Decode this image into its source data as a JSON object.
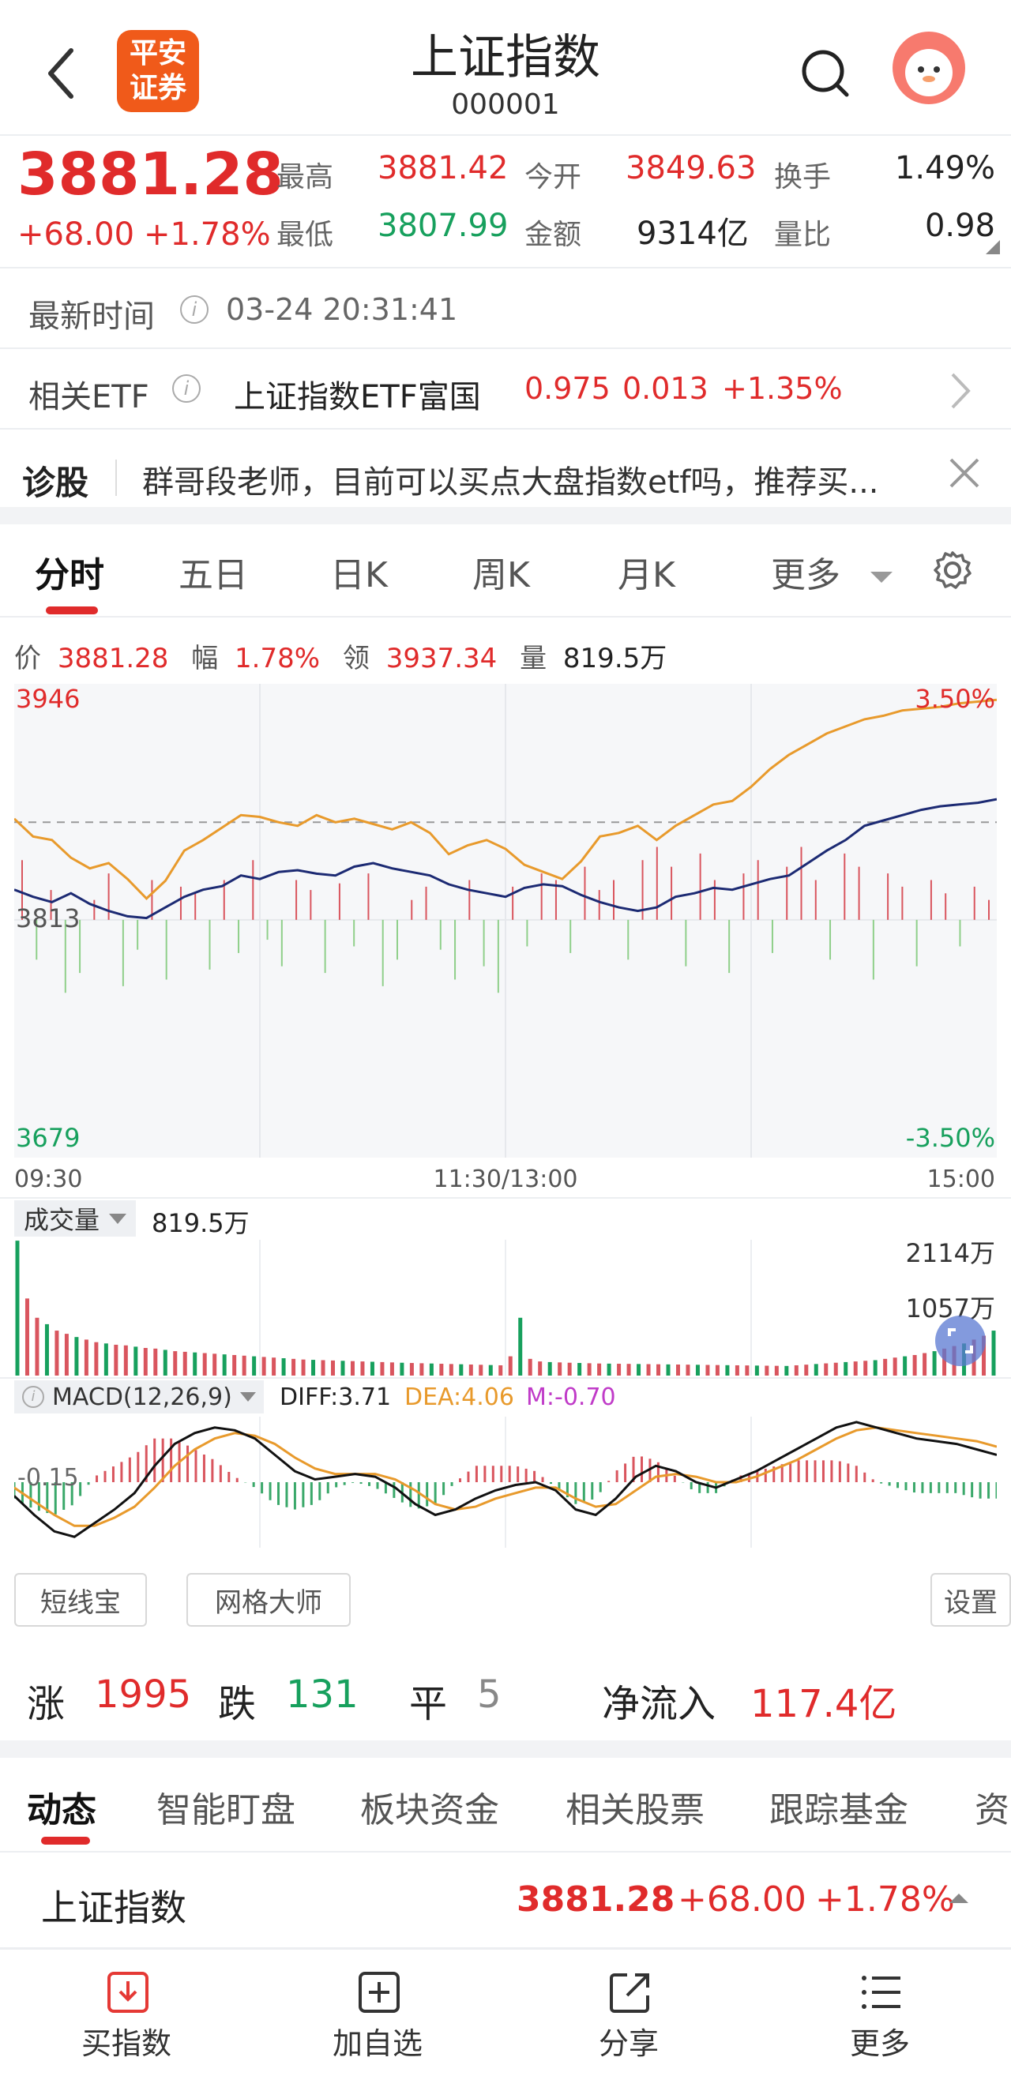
{
  "header": {
    "title": "上证指数",
    "code": "000001",
    "logo_line1": "平安",
    "logo_line2": "证券"
  },
  "quote": {
    "price": "3881.28",
    "change": "+68.00",
    "change_pct": "+1.78%",
    "stats": [
      {
        "label": "最高",
        "value": "3881.42",
        "tone": "red"
      },
      {
        "label": "今开",
        "value": "3849.63",
        "tone": "red"
      },
      {
        "label": "换手",
        "value": "1.49%",
        "tone": "plain"
      },
      {
        "label": "最低",
        "value": "3807.99",
        "tone": "green"
      },
      {
        "label": "金额",
        "value": "9314亿",
        "tone": "plain"
      },
      {
        "label": "量比",
        "value": "0.98",
        "tone": "plain"
      }
    ]
  },
  "update": {
    "label": "最新时间",
    "time": "03-24 20:31:41"
  },
  "etf": {
    "label": "相关ETF",
    "name": "上证指数ETF富国",
    "price": "0.975",
    "change": "0.013",
    "pct": "+1.35%"
  },
  "diagnose": {
    "label": "诊股",
    "text": "群哥段老师，目前可以买点大盘指数etf吗，推荐买..."
  },
  "chart_tabs": [
    "分时",
    "五日",
    "日K",
    "周K",
    "月K",
    "更多"
  ],
  "info_bar": {
    "price_label": "价",
    "price": "3881.28",
    "amp_label": "幅",
    "amp": "1.78%",
    "lead_label": "领",
    "lead": "3937.34",
    "vol_label": "量",
    "vol": "819.5万"
  },
  "chart_data": {
    "type": "line",
    "y_labels": {
      "top": "3946",
      "mid": "3813",
      "bottom": "3679",
      "top_pct": "3.50%",
      "bottom_pct": "-3.50%"
    },
    "x_labels": [
      "09:30",
      "11:30/13:00",
      "15:00"
    ],
    "ylim": [
      3679,
      3946
    ],
    "prev_close": 3813,
    "series": [
      {
        "role": "price",
        "color": "#1c2a73",
        "values": [
          3830,
          3826,
          3823,
          3828,
          3822,
          3818,
          3815,
          3814,
          3820,
          3826,
          3830,
          3832,
          3838,
          3836,
          3840,
          3841,
          3839,
          3838,
          3843,
          3845,
          3842,
          3840,
          3838,
          3833,
          3830,
          3828,
          3826,
          3831,
          3833,
          3832,
          3827,
          3823,
          3820,
          3818,
          3820,
          3826,
          3828,
          3831,
          3830,
          3833,
          3836,
          3838,
          3845,
          3852,
          3858,
          3866,
          3869,
          3872,
          3875,
          3877,
          3878,
          3879,
          3881
        ]
      },
      {
        "role": "lead",
        "color": "#e89a2c",
        "values": [
          3870,
          3860,
          3858,
          3848,
          3842,
          3845,
          3836,
          3825,
          3835,
          3852,
          3858,
          3865,
          3872,
          3871,
          3868,
          3866,
          3872,
          3868,
          3870,
          3867,
          3864,
          3868,
          3862,
          3850,
          3855,
          3858,
          3853,
          3844,
          3840,
          3836,
          3846,
          3860,
          3862,
          3866,
          3858,
          3866,
          3872,
          3878,
          3880,
          3888,
          3898,
          3906,
          3912,
          3918,
          3922,
          3926,
          3928,
          3931,
          3932,
          3933,
          3935,
          3936,
          3937
        ]
      }
    ],
    "volume_bars": [
      18,
      -12,
      9,
      -22,
      -16,
      6,
      14,
      -20,
      -9,
      12,
      -18,
      10,
      8,
      -15,
      12,
      -10,
      18,
      -6,
      -14,
      12,
      9,
      -16,
      11,
      -8,
      14,
      -20,
      -12,
      6,
      10,
      -9,
      -18,
      12,
      -14,
      -22,
      10,
      -8,
      14,
      12,
      -10,
      16,
      9,
      12,
      -12,
      18,
      22,
      16,
      -14,
      20,
      12,
      -16,
      14,
      18,
      -10,
      16,
      22,
      12,
      -12,
      20,
      16,
      -18,
      14,
      10,
      -14,
      12,
      8,
      -8,
      10,
      6
    ],
    "volume_panel": {
      "label": "成交量",
      "value": "819.5万",
      "max_label": "2114万",
      "mid_label": "1057万"
    },
    "volume_values": [
      2100,
      1200,
      900,
      800,
      700,
      650,
      600,
      560,
      520,
      500,
      480,
      470,
      450,
      430,
      420,
      400,
      380,
      370,
      360,
      350,
      340,
      330,
      320,
      310,
      300,
      290,
      280,
      270,
      260,
      250,
      245,
      240,
      235,
      230,
      225,
      220,
      215,
      210,
      205,
      200,
      196,
      192,
      188,
      184,
      180,
      176,
      172,
      168,
      164,
      160,
      300,
      900,
      260,
      220,
      210,
      205,
      200,
      196,
      192,
      188,
      186,
      184,
      182,
      180,
      178,
      176,
      174,
      172,
      170,
      168,
      166,
      164,
      162,
      160,
      158,
      156,
      154,
      152,
      150,
      160,
      170,
      180,
      190,
      200,
      210,
      220,
      230,
      240,
      260,
      280,
      300,
      320,
      350,
      380,
      420,
      460,
      500,
      560,
      620,
      700
    ],
    "macd_panel": {
      "label": "MACD(12,26,9)",
      "diff": "DIFF:3.71",
      "dea": "DEA:4.06",
      "m": "M:-0.70",
      "level": "-0.15"
    },
    "macd_diff": [
      -5,
      -12,
      -18,
      -20,
      -15,
      -10,
      -4,
      6,
      14,
      18,
      20,
      19,
      16,
      10,
      4,
      1,
      2,
      3,
      2,
      -2,
      -8,
      -12,
      -10,
      -6,
      -3,
      -1,
      0,
      -3,
      -10,
      -12,
      -6,
      2,
      6,
      4,
      0,
      -2,
      1,
      4,
      8,
      12,
      16,
      20,
      22,
      20,
      18,
      16,
      15,
      14,
      12,
      10
    ],
    "macd_dea": [
      -2,
      -7,
      -12,
      -16,
      -16,
      -13,
      -9,
      -2,
      6,
      12,
      16,
      18,
      17,
      14,
      9,
      5,
      3,
      3,
      3,
      1,
      -3,
      -8,
      -10,
      -9,
      -6,
      -4,
      -2,
      -2,
      -6,
      -9,
      -8,
      -3,
      2,
      3,
      2,
      0,
      0,
      2,
      5,
      8,
      12,
      16,
      19,
      20,
      19,
      18,
      17,
      16,
      15,
      13
    ]
  },
  "buttons": {
    "short": "短线宝",
    "grid": "网格大师",
    "settings": "设置"
  },
  "breadth": {
    "up_label": "涨",
    "up": "1995",
    "down_label": "跌",
    "down": "131",
    "flat_label": "平",
    "flat": "5",
    "flow_label": "净流入",
    "flow": "117.4亿"
  },
  "sub_tabs": [
    "动态",
    "智能盯盘",
    "板块资金",
    "相关股票",
    "跟踪基金",
    "资"
  ],
  "ticker": {
    "name": "上证指数",
    "price": "3881.28",
    "change": "+68.00",
    "pct": "+1.78%"
  },
  "bottom_nav": [
    {
      "label": "买指数",
      "icon": "download-icon"
    },
    {
      "label": "加自选",
      "icon": "add-icon"
    },
    {
      "label": "分享",
      "icon": "share-icon"
    },
    {
      "label": "更多",
      "icon": "menu-icon"
    }
  ],
  "colors": {
    "red": "#e02b2b",
    "green": "#17a05d",
    "navy": "#1c2a73",
    "orange": "#e89a2c",
    "accent": "#e53935"
  }
}
